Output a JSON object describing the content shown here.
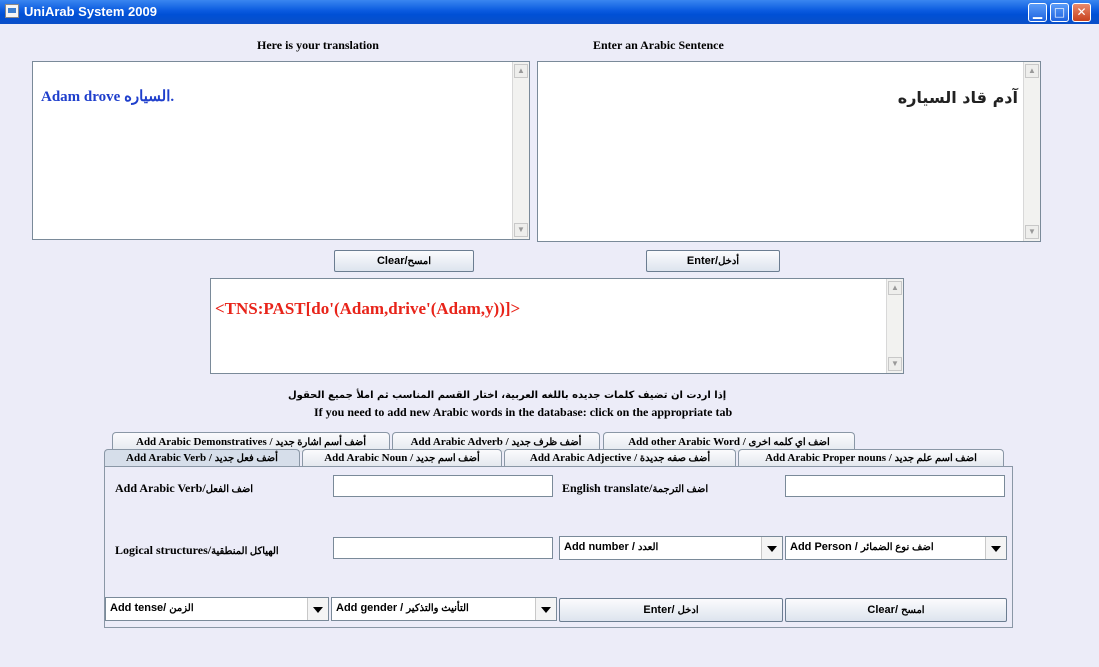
{
  "window": {
    "title": "UniArab System 2009",
    "controls": [
      "minimize-icon",
      "maximize-icon",
      "close-icon"
    ]
  },
  "translation_label": "Here is your translation",
  "arabic_input_label": "Enter an Arabic Sentence",
  "translation_output": {
    "english": "Adam drove ",
    "arabic_word": "السياره",
    "period": ".",
    "color": "#1F3FCC"
  },
  "arabic_input": {
    "value": "آدم قاد السياره"
  },
  "buttons": {
    "clear_en": "Clear/",
    "clear_ar": "امسح",
    "enter_en": "Enter/",
    "enter_ar": "أدخل"
  },
  "logical_structure": {
    "value": "<TNS:PAST[do'(Adam,drive'(Adam,y))]>",
    "color": "#E8241A"
  },
  "instructions": {
    "arabic": "إذا اردت ان تضيف كلمات جديده باللغه العربية، اختار القسم المناسب ثم املأ جميع الحقول",
    "english": "If you need to add new Arabic words in the database: click on the appropriate tab"
  },
  "tabs_row1": [
    {
      "en": "Add Arabic Demonstratives / ",
      "ar": "أضف أسم اشارة جديد"
    },
    {
      "en": "Add Arabic Adverb / ",
      "ar": "أضف ظرف جديد"
    },
    {
      "en": "Add other Arabic Word / ",
      "ar": "اضف اي كلمه اخرى"
    }
  ],
  "tabs_row2": [
    {
      "en": "Add Arabic Verb / ",
      "ar": "أضف فعل جديد",
      "active": true
    },
    {
      "en": "Add Arabic Noun / ",
      "ar": "أضف اسم جديد"
    },
    {
      "en": "Add Arabic Adjective / ",
      "ar": "أضف صفه جديدة"
    },
    {
      "en": "Add Arabic Proper nouns / ",
      "ar": "اضف اسم علم جديد"
    }
  ],
  "verb_form": {
    "verb_label_en": "Add Arabic Verb/",
    "verb_label_ar": "اضف الفعل",
    "verb_value": "",
    "translate_label_en": "English translate/",
    "translate_label_ar": "اضف الترجمة",
    "translate_value": "",
    "logical_label_en": "Logical structures/",
    "logical_label_ar": "الهياكل المنطقية",
    "logical_value": "",
    "number_en": "Add number / ",
    "number_ar": "العدد",
    "person_en": "Add Person / ",
    "person_ar": "اضف نوع الضمائر",
    "tense_en": "Add tense/ ",
    "tense_ar": "الزمن",
    "gender_en": "Add gender / ",
    "gender_ar": "التأنيث والتذكير",
    "enter_en": "Enter/ ",
    "enter_ar": "ادخل",
    "clear_en": "Clear/ ",
    "clear_ar": "امسح"
  }
}
